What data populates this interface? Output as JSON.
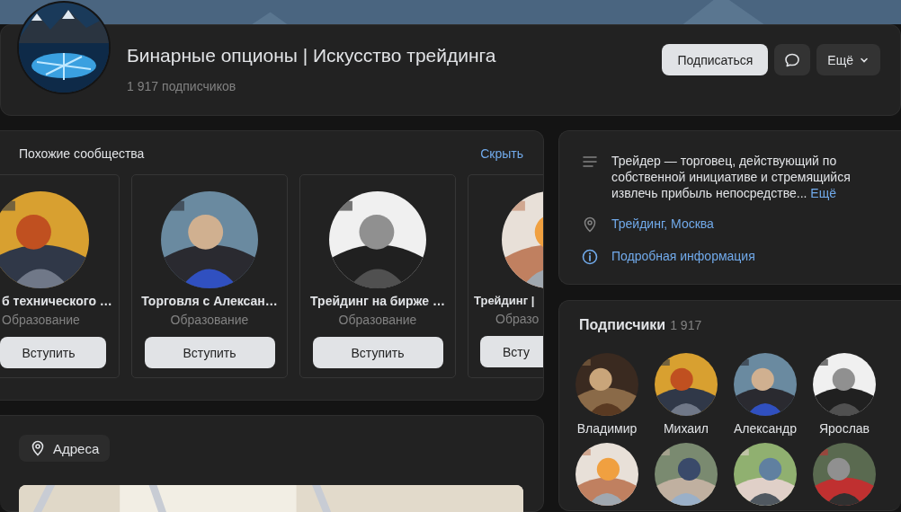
{
  "cover": {
    "kind": "picture"
  },
  "header": {
    "avatar": {
      "kind": "picture"
    },
    "title": "Бинарные опционы | Искусство трейдинга",
    "subscribers_count": "1 917",
    "subscribers_label": "подписчиков",
    "subscribe_button": "Подписаться",
    "more_button": "Ещё"
  },
  "similar": {
    "title": "Похожие сообщества",
    "hide_link": "Скрыть",
    "cards": [
      {
        "kind": "cut_left",
        "name": "б технического …",
        "category": "Образование",
        "button": "Вступить"
      },
      {
        "kind": "full",
        "name": "Торговля с Алексан…",
        "category": "Образование",
        "button": "Вступить"
      },
      {
        "kind": "full",
        "name": "Трейдинг на бирже …",
        "category": "Образование",
        "button": "Вступить"
      },
      {
        "kind": "cut_right",
        "name": "Трейдинг |",
        "category": "Образо",
        "button": "Всту"
      }
    ]
  },
  "addresses": {
    "label": "Адреса",
    "map": {
      "kind": "picture"
    }
  },
  "info": {
    "description": "Трейдер — торговец, действующий по собственной инициативе и стремящийся извлечь прибыль непосредстве...",
    "more_link": "Ещё",
    "location": "Трейдинг, Москва",
    "details_link": "Подробная информация"
  },
  "subscribers": {
    "title": "Подписчики",
    "count": "1 917",
    "people": [
      {
        "kind": "picture",
        "name": "Владимир"
      },
      {
        "kind": "picture",
        "name": "Михаил"
      },
      {
        "kind": "picture",
        "name": "Александр"
      },
      {
        "kind": "picture",
        "name": "Ярослав"
      },
      {
        "kind": "picture"
      },
      {
        "kind": "picture"
      },
      {
        "kind": "picture"
      },
      {
        "kind": "picture"
      }
    ]
  }
}
